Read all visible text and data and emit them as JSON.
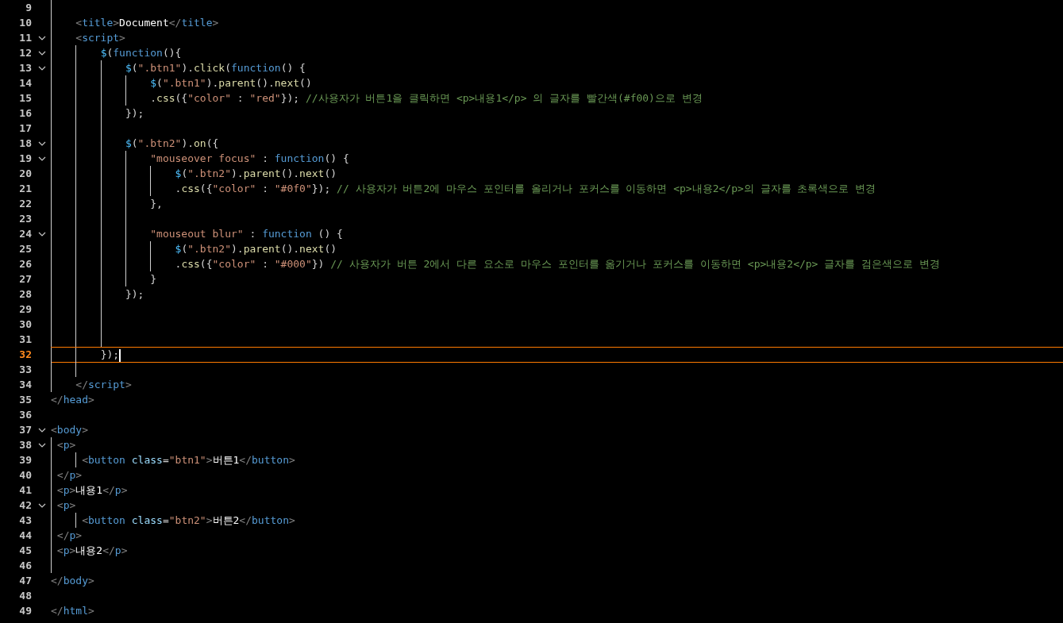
{
  "editor": {
    "lines": [
      {
        "number": "9",
        "foldable": false,
        "current": false
      },
      {
        "number": "10",
        "foldable": false,
        "current": false,
        "tokens": [
          {
            "kind": "br",
            "text": "    <"
          },
          {
            "kind": "tag",
            "text": "title"
          },
          {
            "kind": "br",
            "text": ">"
          },
          {
            "kind": "text",
            "text": "Document"
          },
          {
            "kind": "br",
            "text": "</"
          },
          {
            "kind": "tag",
            "text": "title"
          },
          {
            "kind": "br",
            "text": ">"
          }
        ]
      },
      {
        "number": "11",
        "foldable": true,
        "current": false,
        "tokens": [
          {
            "kind": "br",
            "text": "    <"
          },
          {
            "kind": "tag",
            "text": "script"
          },
          {
            "kind": "br",
            "text": ">"
          }
        ]
      },
      {
        "number": "12",
        "foldable": true,
        "current": false,
        "tokens": [
          {
            "kind": "var",
            "text": "        $"
          },
          {
            "kind": "p",
            "text": "("
          },
          {
            "kind": "kw",
            "text": "function"
          },
          {
            "kind": "p",
            "text": "(){"
          }
        ]
      },
      {
        "number": "13",
        "foldable": true,
        "current": false,
        "tokens": [
          {
            "kind": "var",
            "text": "            $"
          },
          {
            "kind": "p",
            "text": "("
          },
          {
            "kind": "str",
            "text": "\".btn1\""
          },
          {
            "kind": "p",
            "text": ")."
          },
          {
            "kind": "fn",
            "text": "click"
          },
          {
            "kind": "p",
            "text": "("
          },
          {
            "kind": "kw",
            "text": "function"
          },
          {
            "kind": "p",
            "text": "() {"
          }
        ]
      },
      {
        "number": "14",
        "foldable": false,
        "current": false,
        "tokens": [
          {
            "kind": "var",
            "text": "                $"
          },
          {
            "kind": "p",
            "text": "("
          },
          {
            "kind": "str",
            "text": "\".btn1\""
          },
          {
            "kind": "p",
            "text": ")."
          },
          {
            "kind": "fn",
            "text": "parent"
          },
          {
            "kind": "p",
            "text": "()."
          },
          {
            "kind": "fn",
            "text": "next"
          },
          {
            "kind": "p",
            "text": "()"
          }
        ]
      },
      {
        "number": "15",
        "foldable": false,
        "current": false,
        "tokens": [
          {
            "kind": "p",
            "text": "                ."
          },
          {
            "kind": "fn",
            "text": "css"
          },
          {
            "kind": "p",
            "text": "({"
          },
          {
            "kind": "str",
            "text": "\"color\""
          },
          {
            "kind": "p",
            "text": " : "
          },
          {
            "kind": "str",
            "text": "\"red\""
          },
          {
            "kind": "p",
            "text": "});"
          },
          {
            "kind": "cm",
            "text": " //사용자가 버튼1을 클릭하면 <p>내용1</p> 의 글자를 빨간색(#f00)으로 변경"
          }
        ]
      },
      {
        "number": "16",
        "foldable": false,
        "current": false,
        "tokens": [
          {
            "kind": "p",
            "text": "            });"
          }
        ]
      },
      {
        "number": "17",
        "foldable": false,
        "current": false
      },
      {
        "number": "18",
        "foldable": true,
        "current": false,
        "tokens": [
          {
            "kind": "var",
            "text": "            $"
          },
          {
            "kind": "p",
            "text": "("
          },
          {
            "kind": "str",
            "text": "\".btn2\""
          },
          {
            "kind": "p",
            "text": ")."
          },
          {
            "kind": "fn",
            "text": "on"
          },
          {
            "kind": "p",
            "text": "({"
          }
        ]
      },
      {
        "number": "19",
        "foldable": true,
        "current": false,
        "tokens": [
          {
            "kind": "str",
            "text": "                \"mouseover focus\""
          },
          {
            "kind": "p",
            "text": " : "
          },
          {
            "kind": "kw",
            "text": "function"
          },
          {
            "kind": "p",
            "text": "() {"
          }
        ]
      },
      {
        "number": "20",
        "foldable": false,
        "current": false,
        "tokens": [
          {
            "kind": "var",
            "text": "                    $"
          },
          {
            "kind": "p",
            "text": "("
          },
          {
            "kind": "str",
            "text": "\".btn2\""
          },
          {
            "kind": "p",
            "text": ")."
          },
          {
            "kind": "fn",
            "text": "parent"
          },
          {
            "kind": "p",
            "text": "()."
          },
          {
            "kind": "fn",
            "text": "next"
          },
          {
            "kind": "p",
            "text": "()"
          }
        ]
      },
      {
        "number": "21",
        "foldable": false,
        "current": false,
        "tokens": [
          {
            "kind": "p",
            "text": "                    ."
          },
          {
            "kind": "fn",
            "text": "css"
          },
          {
            "kind": "p",
            "text": "({"
          },
          {
            "kind": "str",
            "text": "\"color\""
          },
          {
            "kind": "p",
            "text": " : "
          },
          {
            "kind": "str",
            "text": "\"#0f0\""
          },
          {
            "kind": "p",
            "text": "});"
          },
          {
            "kind": "cm",
            "text": " // 사용자가 버튼2에 마우스 포인터를 올리거나 포커스를 이동하면 <p>내용2</p>의 글자를 초록색으로 변경"
          }
        ]
      },
      {
        "number": "22",
        "foldable": false,
        "current": false,
        "tokens": [
          {
            "kind": "p",
            "text": "                },"
          }
        ]
      },
      {
        "number": "23",
        "foldable": false,
        "current": false
      },
      {
        "number": "24",
        "foldable": true,
        "current": false,
        "tokens": [
          {
            "kind": "str",
            "text": "                \"mouseout blur\""
          },
          {
            "kind": "p",
            "text": " : "
          },
          {
            "kind": "kw",
            "text": "function"
          },
          {
            "kind": "p",
            "text": " () {"
          }
        ]
      },
      {
        "number": "25",
        "foldable": false,
        "current": false,
        "tokens": [
          {
            "kind": "var",
            "text": "                    $"
          },
          {
            "kind": "p",
            "text": "("
          },
          {
            "kind": "str",
            "text": "\".btn2\""
          },
          {
            "kind": "p",
            "text": ")."
          },
          {
            "kind": "fn",
            "text": "parent"
          },
          {
            "kind": "p",
            "text": "()."
          },
          {
            "kind": "fn",
            "text": "next"
          },
          {
            "kind": "p",
            "text": "()"
          }
        ]
      },
      {
        "number": "26",
        "foldable": false,
        "current": false,
        "tokens": [
          {
            "kind": "p",
            "text": "                    ."
          },
          {
            "kind": "fn",
            "text": "css"
          },
          {
            "kind": "p",
            "text": "({"
          },
          {
            "kind": "str",
            "text": "\"color\""
          },
          {
            "kind": "p",
            "text": " : "
          },
          {
            "kind": "str",
            "text": "\"#000\""
          },
          {
            "kind": "p",
            "text": "})"
          },
          {
            "kind": "cm",
            "text": " // 사용자가 버튼 2에서 다른 요소로 마우스 포인터를 옮기거나 포커스를 이동하면 <p>내용2</p> 글자를 검은색으로 변경"
          }
        ]
      },
      {
        "number": "27",
        "foldable": false,
        "current": false,
        "tokens": [
          {
            "kind": "p",
            "text": "                }"
          }
        ]
      },
      {
        "number": "28",
        "foldable": false,
        "current": false,
        "tokens": [
          {
            "kind": "p",
            "text": "            });"
          }
        ]
      },
      {
        "number": "29",
        "foldable": false,
        "current": false
      },
      {
        "number": "30",
        "foldable": false,
        "current": false
      },
      {
        "number": "31",
        "foldable": false,
        "current": false
      },
      {
        "number": "32",
        "foldable": false,
        "current": true,
        "tokens": [
          {
            "kind": "p",
            "text": "        });"
          }
        ]
      },
      {
        "number": "33",
        "foldable": false,
        "current": false
      },
      {
        "number": "34",
        "foldable": false,
        "current": false,
        "tokens": [
          {
            "kind": "br",
            "text": "    </"
          },
          {
            "kind": "tag",
            "text": "script"
          },
          {
            "kind": "br",
            "text": ">"
          }
        ]
      },
      {
        "number": "35",
        "foldable": false,
        "current": false,
        "tokens": [
          {
            "kind": "br",
            "text": "</"
          },
          {
            "kind": "tag",
            "text": "head"
          },
          {
            "kind": "br",
            "text": ">"
          }
        ]
      },
      {
        "number": "36",
        "foldable": false,
        "current": false
      },
      {
        "number": "37",
        "foldable": true,
        "current": false,
        "tokens": [
          {
            "kind": "br",
            "text": "<"
          },
          {
            "kind": "tag",
            "text": "body"
          },
          {
            "kind": "br",
            "text": ">"
          }
        ]
      },
      {
        "number": "38",
        "foldable": true,
        "current": false,
        "tokens": [
          {
            "kind": "br",
            "text": " <"
          },
          {
            "kind": "tag",
            "text": "p"
          },
          {
            "kind": "br",
            "text": ">"
          }
        ]
      },
      {
        "number": "39",
        "foldable": false,
        "current": false,
        "tokens": [
          {
            "kind": "br",
            "text": "     <"
          },
          {
            "kind": "tag",
            "text": "button"
          },
          {
            "kind": "attr",
            "text": " class"
          },
          {
            "kind": "p",
            "text": "="
          },
          {
            "kind": "str",
            "text": "\"btn1\""
          },
          {
            "kind": "br",
            "text": ">"
          },
          {
            "kind": "text",
            "text": "버튼1"
          },
          {
            "kind": "br",
            "text": "</"
          },
          {
            "kind": "tag",
            "text": "button"
          },
          {
            "kind": "br",
            "text": ">"
          }
        ]
      },
      {
        "number": "40",
        "foldable": false,
        "current": false,
        "tokens": [
          {
            "kind": "br",
            "text": " </"
          },
          {
            "kind": "tag",
            "text": "p"
          },
          {
            "kind": "br",
            "text": ">"
          }
        ]
      },
      {
        "number": "41",
        "foldable": false,
        "current": false,
        "tokens": [
          {
            "kind": "br",
            "text": " <"
          },
          {
            "kind": "tag",
            "text": "p"
          },
          {
            "kind": "br",
            "text": ">"
          },
          {
            "kind": "text",
            "text": "내용1"
          },
          {
            "kind": "br",
            "text": "</"
          },
          {
            "kind": "tag",
            "text": "p"
          },
          {
            "kind": "br",
            "text": ">"
          }
        ]
      },
      {
        "number": "42",
        "foldable": true,
        "current": false,
        "tokens": [
          {
            "kind": "br",
            "text": " <"
          },
          {
            "kind": "tag",
            "text": "p"
          },
          {
            "kind": "br",
            "text": ">"
          }
        ]
      },
      {
        "number": "43",
        "foldable": false,
        "current": false,
        "tokens": [
          {
            "kind": "br",
            "text": "     <"
          },
          {
            "kind": "tag",
            "text": "button"
          },
          {
            "kind": "attr",
            "text": " class"
          },
          {
            "kind": "p",
            "text": "="
          },
          {
            "kind": "str",
            "text": "\"btn2\""
          },
          {
            "kind": "br",
            "text": ">"
          },
          {
            "kind": "text",
            "text": "버튼2"
          },
          {
            "kind": "br",
            "text": "</"
          },
          {
            "kind": "tag",
            "text": "button"
          },
          {
            "kind": "br",
            "text": ">"
          }
        ]
      },
      {
        "number": "44",
        "foldable": false,
        "current": false,
        "tokens": [
          {
            "kind": "br",
            "text": " </"
          },
          {
            "kind": "tag",
            "text": "p"
          },
          {
            "kind": "br",
            "text": ">"
          }
        ]
      },
      {
        "number": "45",
        "foldable": false,
        "current": false,
        "tokens": [
          {
            "kind": "br",
            "text": " <"
          },
          {
            "kind": "tag",
            "text": "p"
          },
          {
            "kind": "br",
            "text": ">"
          },
          {
            "kind": "text",
            "text": "내용2"
          },
          {
            "kind": "br",
            "text": "</"
          },
          {
            "kind": "tag",
            "text": "p"
          },
          {
            "kind": "br",
            "text": ">"
          }
        ]
      },
      {
        "number": "46",
        "foldable": false,
        "current": false
      },
      {
        "number": "47",
        "foldable": false,
        "current": false,
        "tokens": [
          {
            "kind": "br",
            "text": "</"
          },
          {
            "kind": "tag",
            "text": "body"
          },
          {
            "kind": "br",
            "text": ">"
          }
        ]
      },
      {
        "number": "48",
        "foldable": false,
        "current": false
      },
      {
        "number": "49",
        "foldable": false,
        "current": false,
        "tokens": [
          {
            "kind": "br",
            "text": "</"
          },
          {
            "kind": "tag",
            "text": "html"
          },
          {
            "kind": "br",
            "text": ">"
          }
        ]
      }
    ]
  }
}
